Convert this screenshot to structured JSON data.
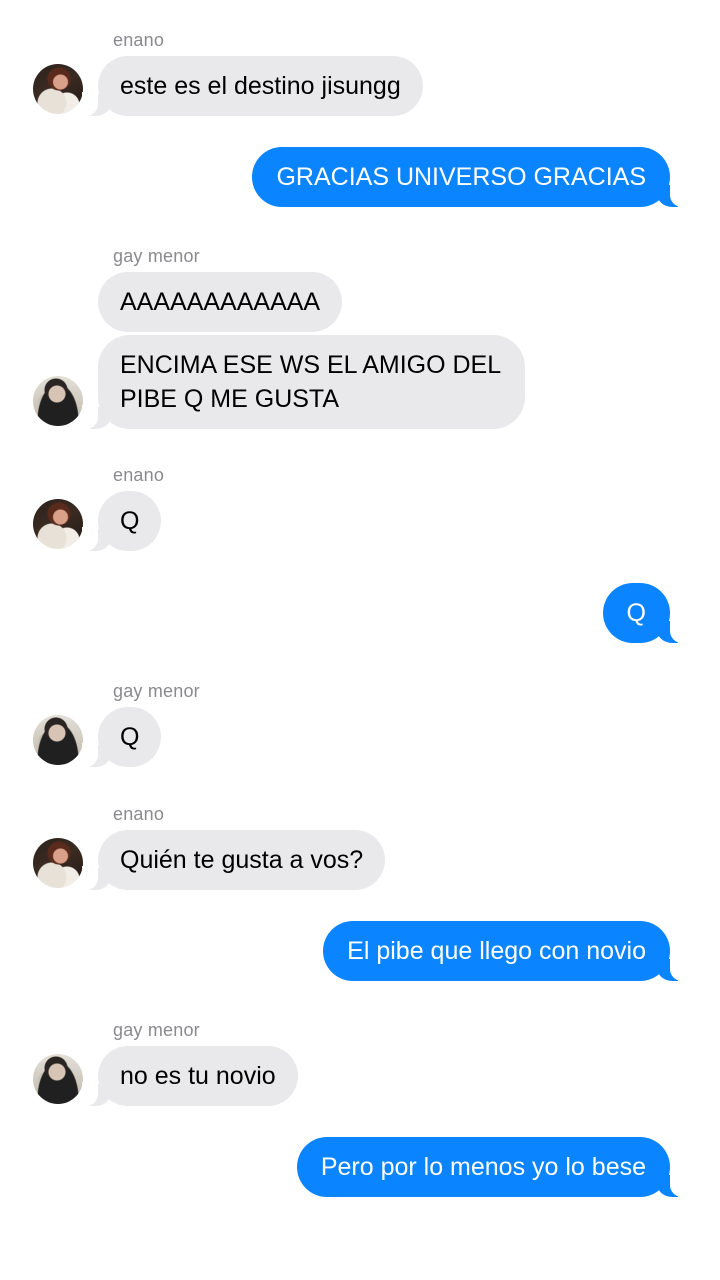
{
  "contacts": {
    "enano": {
      "name": "enano",
      "avatar_icon": "avatar-photo"
    },
    "gay_menor": {
      "name": "gay menor",
      "avatar_icon": "avatar-photo"
    }
  },
  "colors": {
    "outgoing_bubble": "#0b84ff",
    "incoming_bubble": "#e9e9eb",
    "sender_label": "#8a8a8e",
    "background": "#ffffff"
  },
  "messages": [
    {
      "from": "enano",
      "direction": "incoming",
      "text": "este es el destino jisungg"
    },
    {
      "from": "me",
      "direction": "outgoing",
      "text": "GRACIAS UNIVERSO GRACIAS"
    },
    {
      "from": "gay menor",
      "direction": "incoming",
      "text": "AAAAAAAAAAAA"
    },
    {
      "from": "gay menor",
      "direction": "incoming",
      "text": "ENCIMA ESE WS EL AMIGO DEL PIBE Q ME GUSTA"
    },
    {
      "from": "enano",
      "direction": "incoming",
      "text": "Q"
    },
    {
      "from": "me",
      "direction": "outgoing",
      "text": "Q"
    },
    {
      "from": "gay menor",
      "direction": "incoming",
      "text": "Q"
    },
    {
      "from": "enano",
      "direction": "incoming",
      "text": "Quién te gusta a vos?"
    },
    {
      "from": "me",
      "direction": "outgoing",
      "text": "El pibe que llego con novio"
    },
    {
      "from": "gay menor",
      "direction": "incoming",
      "text": "no es tu novio"
    },
    {
      "from": "me",
      "direction": "outgoing",
      "text": "Pero por lo menos yo lo bese"
    }
  ]
}
